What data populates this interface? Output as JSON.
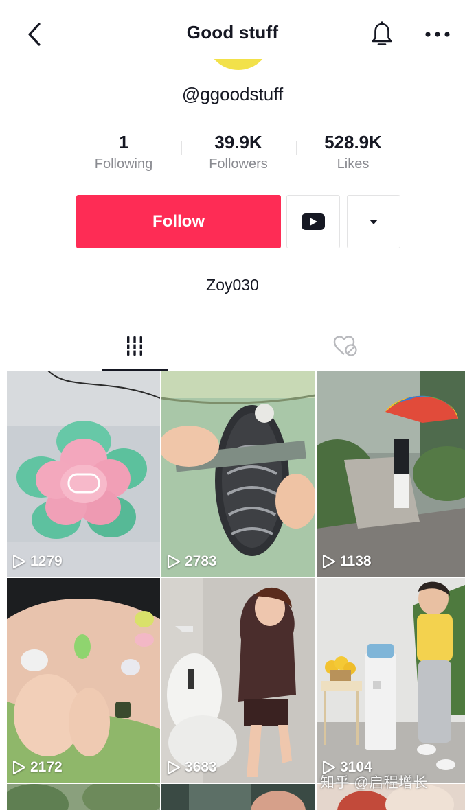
{
  "header": {
    "title": "Good stuff",
    "back_icon": "chevron-left-icon",
    "bell_icon": "bell-icon",
    "more_icon": "more-horizontal-icon"
  },
  "profile": {
    "handle": "@ggoodstuff",
    "avatar_color": "#f2e14a",
    "bio": "Zoy030"
  },
  "stats": [
    {
      "value": "1",
      "label": "Following"
    },
    {
      "value": "39.9K",
      "label": "Followers"
    },
    {
      "value": "528.9K",
      "label": "Likes"
    }
  ],
  "actions": {
    "follow_label": "Follow",
    "follow_color": "#fe2c55",
    "youtube_icon": "youtube-icon",
    "dropdown_icon": "caret-down-icon"
  },
  "tabs": [
    {
      "name": "videos",
      "icon": "grid-icon",
      "active": true
    },
    {
      "name": "liked",
      "icon": "liked-hidden-icon",
      "active": false
    }
  ],
  "videos": [
    {
      "views": "1279"
    },
    {
      "views": "2783"
    },
    {
      "views": "1138"
    },
    {
      "views": "2172"
    },
    {
      "views": "3683"
    },
    {
      "views": "3104"
    }
  ],
  "watermark": "知乎 @启程增长"
}
